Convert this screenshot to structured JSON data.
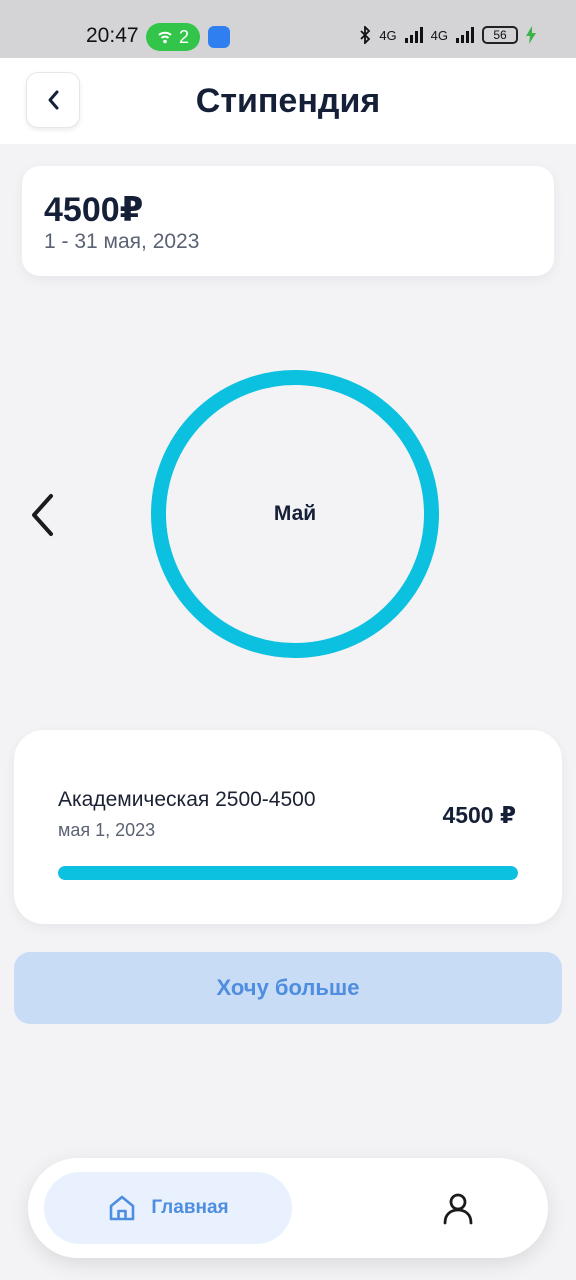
{
  "status_bar": {
    "time": "20:47",
    "hotspot_count": "2",
    "battery": "56",
    "network_1": "4G",
    "network_2": "4G"
  },
  "header": {
    "title": "Стипендия",
    "back_icon": "chevron-left-icon"
  },
  "summary": {
    "amount": "4500₽",
    "period": "1 - 31 мая, 2023"
  },
  "month_ring": {
    "label": "Май",
    "prev_icon": "chevron-left-icon",
    "ring_color": "#0cc0e0"
  },
  "scholarship": {
    "name": "Академическая 2500-4500",
    "date": "мая 1, 2023",
    "amount": "4500 ₽",
    "progress_fraction": 1.0
  },
  "actions": {
    "more_label": "Хочу больше"
  },
  "bottom_nav": {
    "home_label": "Главная",
    "home_icon": "home-icon",
    "profile_icon": "user-icon"
  },
  "colors": {
    "accent": "#0cc0e0",
    "primary_text": "#152038",
    "button_bg": "#c9dcf6",
    "button_text": "#4e8ddf"
  }
}
